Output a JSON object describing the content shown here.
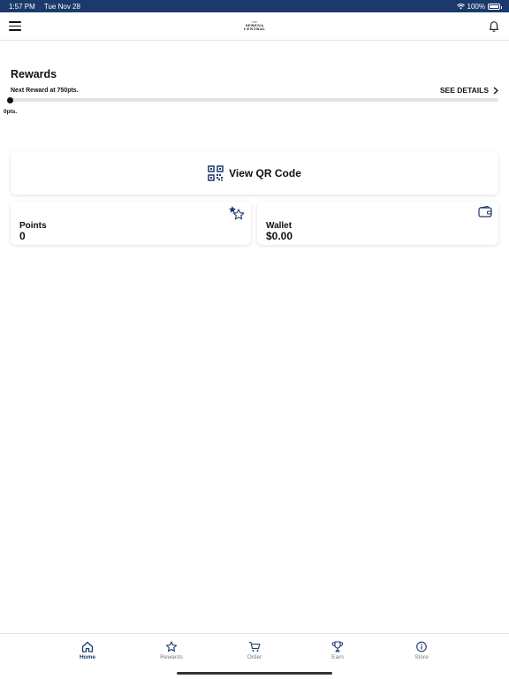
{
  "status_bar": {
    "time": "1:57 PM",
    "date": "Tue Nov 28",
    "battery": "100%",
    "battery_level": 1.0,
    "wifi_icon": "wifi-icon"
  },
  "header": {
    "logo": {
      "top": "THE",
      "line1": "SERENA",
      "line2": "CENTRAL"
    },
    "menu_icon": "menu-icon",
    "notification_icon": "bell-icon"
  },
  "rewards": {
    "title": "Rewards",
    "next_reward": "Next Reward at 750pts.",
    "see_details": "SEE DETAILS",
    "progress_fraction": 0,
    "points_label": "0pts."
  },
  "qr": {
    "label": "View QR Code",
    "icon": "qr-code-icon"
  },
  "points_card": {
    "label": "Points",
    "value": "0",
    "icon": "stars-icon"
  },
  "wallet_card": {
    "label": "Wallet",
    "value": "$0.00",
    "icon": "wallet-icon"
  },
  "tabs": [
    {
      "label": "Home",
      "icon": "home-icon",
      "active": true
    },
    {
      "label": "Rewards",
      "icon": "star-icon",
      "active": false
    },
    {
      "label": "Order",
      "icon": "cart-icon",
      "active": false
    },
    {
      "label": "Earn",
      "icon": "trophy-icon",
      "active": false
    },
    {
      "label": "Store",
      "icon": "info-icon",
      "active": false
    }
  ],
  "colors": {
    "brand": "#1b3a6b",
    "text": "#111111",
    "inactive_tab": "#7a7a7a",
    "track": "#e3e3e3"
  }
}
